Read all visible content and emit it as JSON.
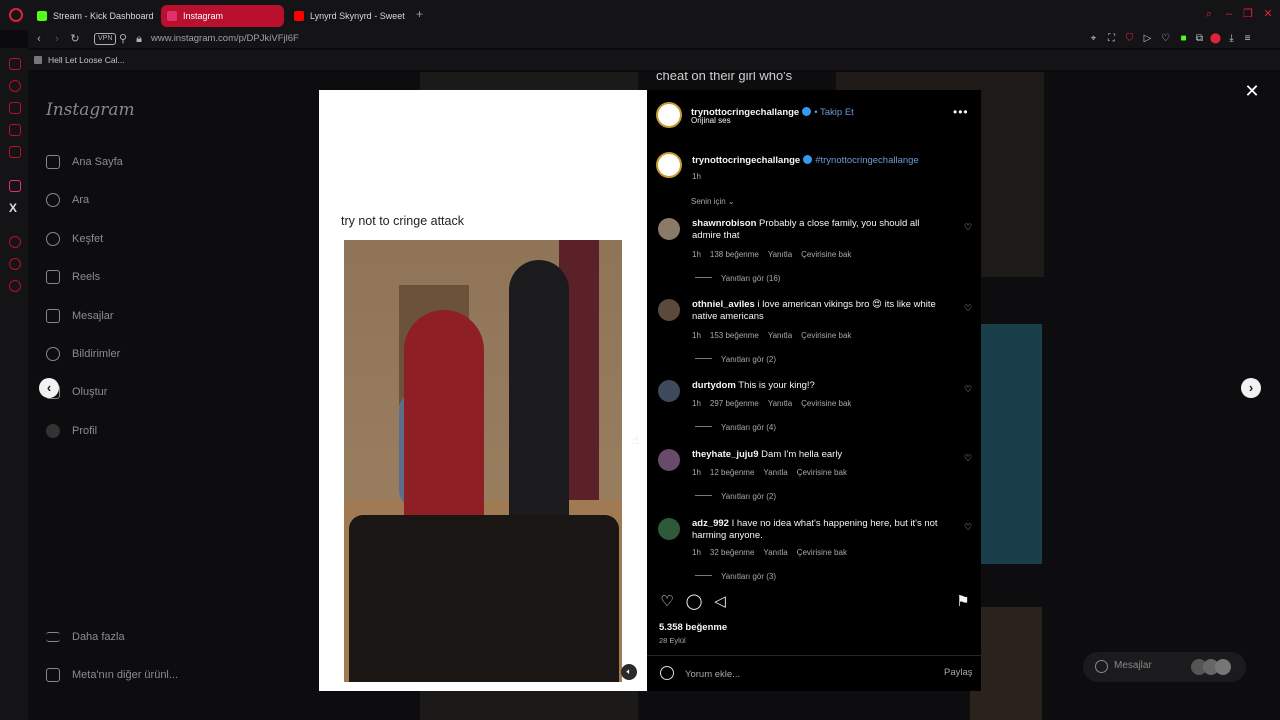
{
  "browser": {
    "tabs": [
      {
        "label": "Stream - Kick Dashboard",
        "favicon_color": "#53fc18"
      },
      {
        "label": "Instagram",
        "favicon_color": "#e1306c"
      },
      {
        "label": "Lynyrd Skynyrd - Sweet H",
        "favicon_color": "#ff0000"
      }
    ],
    "url": "www.instagram.com/p/DPJkiVFjl6F",
    "vpn_label": "VPN",
    "bookmark": "Hell Let Loose Cal..."
  },
  "instagram_nav": {
    "logo": "Instagram",
    "items": [
      {
        "label": "Ana Sayfa",
        "icon": "home-icon"
      },
      {
        "label": "Ara",
        "icon": "search-icon"
      },
      {
        "label": "Keşfet",
        "icon": "compass-icon"
      },
      {
        "label": "Reels",
        "icon": "reels-icon"
      },
      {
        "label": "Mesajlar",
        "icon": "send-icon"
      },
      {
        "label": "Bildirimler",
        "icon": "heart-icon"
      },
      {
        "label": "Oluştur",
        "icon": "plus-icon"
      },
      {
        "label": "Profil",
        "icon": "avatar-icon"
      }
    ],
    "more": "Daha fazla",
    "meta": "Meta'nın diğer ürünl..."
  },
  "background_text": "cheat on their girl who's",
  "post": {
    "caption_overlay": "try not to cringe attack",
    "author": "trynottocringechallange",
    "follow": "• Takip Et",
    "audio": "Orijinal ses",
    "caption_author": "trynottocringechallange",
    "caption_hashtag": "#trynottocringechallange",
    "caption_time": "1h",
    "sort_label": "Senin için",
    "likes": "5.358 beğenme",
    "date": "28 Eylül",
    "comment_placeholder": "Yorum ekle...",
    "post_button": "Paylaş"
  },
  "comments": [
    {
      "user": "shawnrobison",
      "text": "Probably a close family, you should all admire that",
      "time": "1h",
      "likes": "138 beğenme",
      "reply": "Yanıtla",
      "translate": "Çevirisine bak",
      "replies": "Yanıtları gör (16)"
    },
    {
      "user": "othniel_aviles",
      "text": "i love american vikings bro 😍 its like white native americans",
      "time": "1h",
      "likes": "153 beğenme",
      "reply": "Yanıtla",
      "translate": "Çevirisine bak",
      "replies": "Yanıtları gör (2)"
    },
    {
      "user": "durtydom",
      "text": "This is your king!?",
      "time": "1h",
      "likes": "297 beğenme",
      "reply": "Yanıtla",
      "translate": "Çevirisine bak",
      "replies": "Yanıtları gör (4)"
    },
    {
      "user": "theyhate_juju9",
      "text": "Dam I'm hella early",
      "time": "1h",
      "likes": "12 beğenme",
      "reply": "Yanıtla",
      "translate": "Çevirisine bak",
      "replies": "Yanıtları gör (2)"
    },
    {
      "user": "adz_992",
      "text": "I have no idea what's happening here, but it's not harming anyone.",
      "time": "1h",
      "likes": "32 beğenme",
      "reply": "Yanıtla",
      "translate": "Çevirisine bak",
      "replies": "Yanıtları gör (3)"
    }
  ],
  "messages_pill": "Mesajlar",
  "colors": {
    "accent": "#b8102e",
    "link": "#6c9bd6",
    "verified": "#3897f0"
  }
}
